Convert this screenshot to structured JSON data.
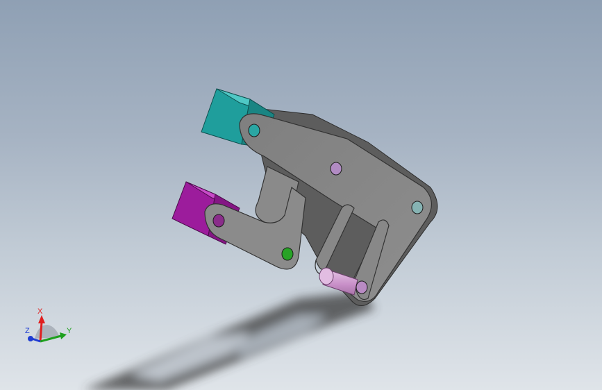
{
  "viewport": {
    "background_top": "#8fa0b4",
    "background_bottom": "#dfe4e9"
  },
  "model": {
    "body_color": "#8c8c8c",
    "body_edge_color": "#3a3a3a",
    "jaw_upper_color": "#22a3a0",
    "jaw_lower_color": "#a51ea5",
    "pin_color": "#d7a8d7",
    "shadow_color": "#3b3b3b",
    "holes": [
      {
        "name": "hole-upper-jaw",
        "color": "#2aa6a3"
      },
      {
        "name": "hole-center",
        "color": "#b18bc3"
      },
      {
        "name": "hole-right",
        "color": "#86b3b3"
      },
      {
        "name": "hole-lower-jaw",
        "color": "#8a2d8a"
      },
      {
        "name": "hole-green",
        "color": "#27a326"
      },
      {
        "name": "hole-pin-end",
        "color": "#b98bc3"
      }
    ]
  },
  "triad": {
    "x_label": "X",
    "y_label": "Y",
    "z_label": "Z",
    "x_color": "#e01e1e",
    "y_color": "#1ea01e",
    "z_color": "#1e3cd2"
  }
}
